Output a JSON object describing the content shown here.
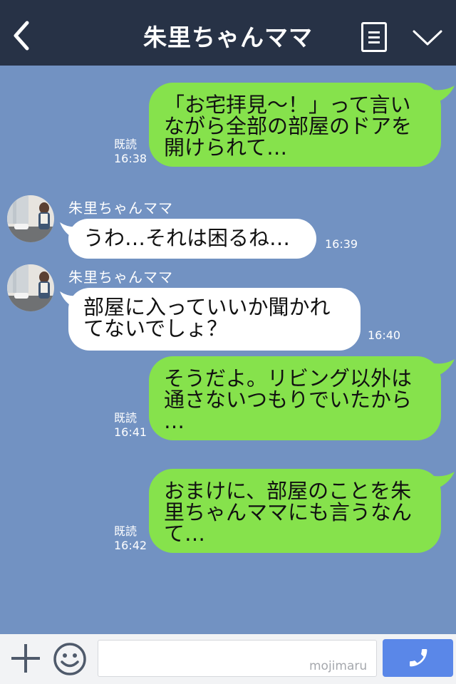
{
  "header": {
    "title": "朱里ちゃんママ",
    "back_icon": "chevron-left-icon",
    "menu_icon": "menu-list-icon",
    "dropdown_icon": "chevron-down-icon"
  },
  "messages": [
    {
      "side": "right",
      "text": "「お宅拝見〜！」って言い\nながら全部の部屋のドアを\n開けられて…",
      "read": "既読",
      "time": "16:38"
    },
    {
      "side": "left",
      "sender": "朱里ちゃんママ",
      "text": "うわ…それは困るね…",
      "time": "16:39"
    },
    {
      "side": "left",
      "sender": "朱里ちゃんママ",
      "text": "部屋に入っていいか聞かれ\nてないでしょ？",
      "time": "16:40"
    },
    {
      "side": "right",
      "text": "そうだよ。リビング以外は\n通さないつもりでいたから\n…",
      "read": "既読",
      "time": "16:41"
    },
    {
      "side": "right",
      "text": "おまけに、部屋のことを朱\n里ちゃんママにも言うなん\nて…",
      "read": "既読",
      "time": "16:42"
    }
  ],
  "input_bar": {
    "placeholder": "",
    "watermark": "mojimaru",
    "plus_icon": "plus-icon",
    "emoji_icon": "smiley-icon",
    "call_icon": "phone-icon"
  },
  "colors": {
    "header_bg": "#273246",
    "chat_bg": "#7292c2",
    "sent_bubble": "#86e24c",
    "received_bubble": "#ffffff",
    "call_button": "#5a87e8"
  }
}
